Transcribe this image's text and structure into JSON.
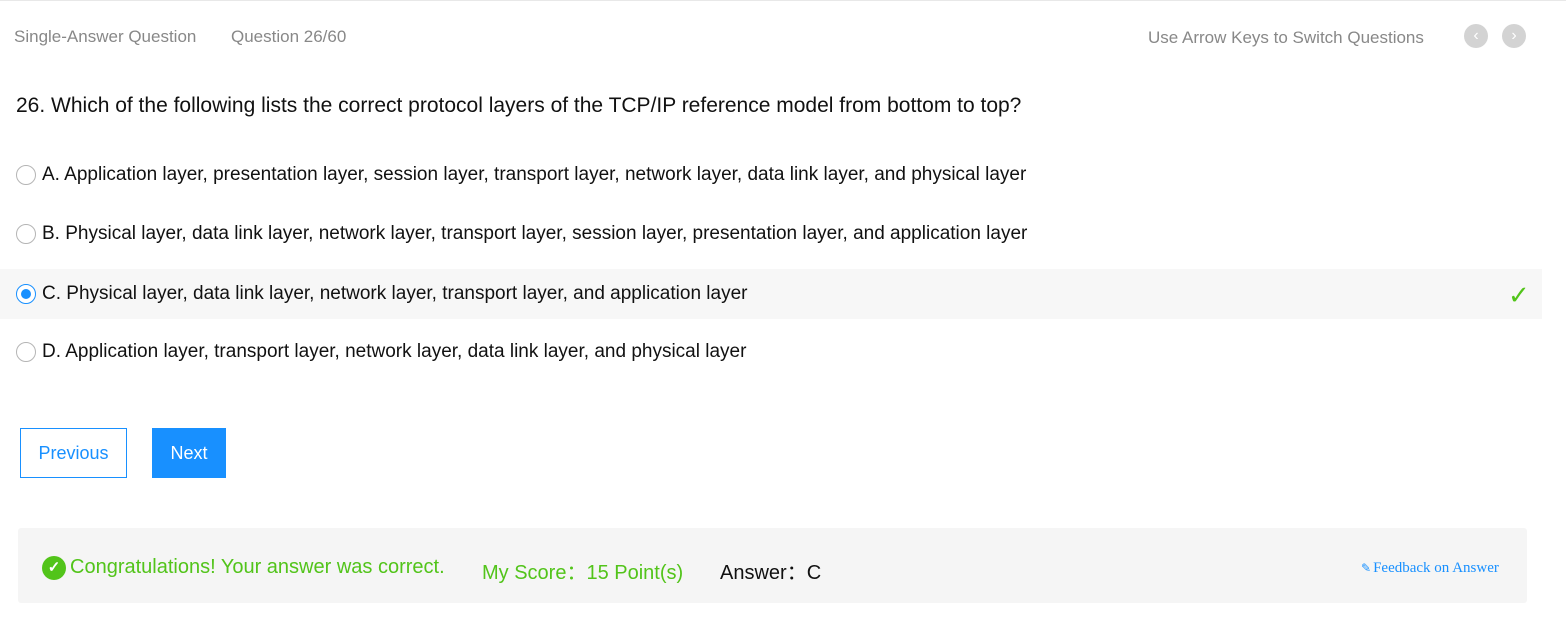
{
  "header": {
    "question_type": "Single-Answer Question",
    "question_counter": "Question 26/60",
    "hint": "Use Arrow Keys to Switch Questions",
    "prev_icon": "chevron-left-icon",
    "next_icon": "chevron-right-icon"
  },
  "question": {
    "text": "26. Which of the following lists the correct protocol layers of the TCP/IP reference model from bottom to top?"
  },
  "options": [
    {
      "label": "A. Application layer, presentation layer, session layer, transport layer, network layer, data link layer, and physical layer",
      "selected": false
    },
    {
      "label": "B. Physical layer, data link layer, network layer, transport layer, session layer, presentation layer, and application layer",
      "selected": false
    },
    {
      "label": "C. Physical layer, data link layer, network layer, transport layer, and application layer",
      "selected": true,
      "correct": true
    },
    {
      "label": "D. Application layer, transport layer, network layer, data link layer, and physical layer",
      "selected": false
    }
  ],
  "buttons": {
    "previous": "Previous",
    "next": "Next"
  },
  "result": {
    "message": "Congratulations! Your answer was correct.",
    "score": "My Score：15 Point(s)",
    "answer": "Answer：C",
    "feedback": "Feedback on Answer"
  },
  "colors": {
    "accent": "#1890ff",
    "success": "#52c41a",
    "muted_text": "#888888"
  }
}
